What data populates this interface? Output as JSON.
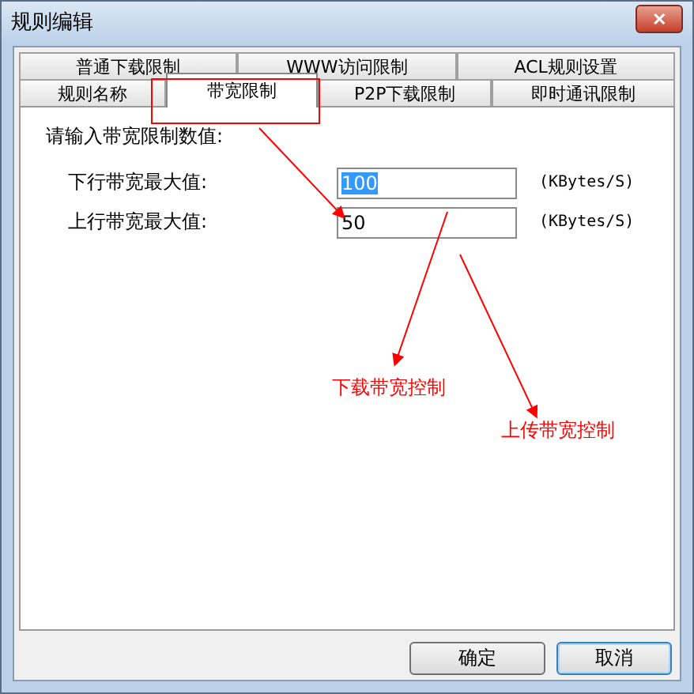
{
  "window": {
    "title": "规则编辑",
    "close": "✕"
  },
  "tab_rows": [
    [
      {
        "label": "普通下载限制",
        "selected": false
      },
      {
        "label": "WWW访问限制",
        "selected": false
      },
      {
        "label": "ACL规则设置",
        "selected": false
      }
    ],
    [
      {
        "label": "规则名称",
        "selected": false
      },
      {
        "label": "带宽限制",
        "selected": true
      },
      {
        "label": "P2P下载限制",
        "selected": false
      },
      {
        "label": "即时通讯限制",
        "selected": false
      }
    ]
  ],
  "panel": {
    "prompt": "请输入带宽限制数值:",
    "fields": [
      {
        "label": "下行带宽最大值:",
        "value": "100",
        "unit": "(KBytes/S)",
        "highlighted": true
      },
      {
        "label": "上行带宽最大值:",
        "value": "50",
        "unit": "(KBytes/S)",
        "highlighted": false
      }
    ]
  },
  "annotations": [
    {
      "label": "下载带宽控制"
    },
    {
      "label": "上传带宽控制"
    }
  ],
  "buttons": [
    {
      "label": "确定",
      "focused": false
    },
    {
      "label": "取消",
      "focused": true
    }
  ]
}
